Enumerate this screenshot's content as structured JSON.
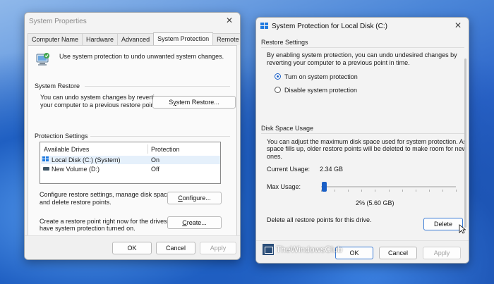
{
  "left_window": {
    "title": "System Properties",
    "close_glyph": "✕",
    "tabs": [
      {
        "label": "Computer Name",
        "active": false
      },
      {
        "label": "Hardware",
        "active": false
      },
      {
        "label": "Advanced",
        "active": false
      },
      {
        "label": "System Protection",
        "active": true
      },
      {
        "label": "Remote",
        "active": false
      }
    ],
    "intro_text": "Use system protection to undo unwanted system changes.",
    "system_restore": {
      "heading": "System Restore",
      "description_line1": "You can undo system changes by reverting",
      "description_line2": "your computer to a previous restore point.",
      "button_pre": "S",
      "button_ul": "y",
      "button_post": "stem Restore..."
    },
    "protection_settings": {
      "heading": "Protection Settings",
      "columns": [
        "Available Drives",
        "Protection"
      ],
      "rows": [
        {
          "drive": "Local Disk (C:) (System)",
          "protection": "On",
          "icon": "windows-drive-icon",
          "selected": true
        },
        {
          "drive": "New Volume (D:)",
          "protection": "Off",
          "icon": "drive-icon",
          "selected": false
        }
      ]
    },
    "configure": {
      "line1": "Configure restore settings, manage disk space,",
      "line2": "and delete restore points.",
      "button_ul": "C",
      "button_post": "onfigure..."
    },
    "create": {
      "line1": "Create a restore point right now for the drives that",
      "line2": "have system protection turned on.",
      "button_ul": "C",
      "button_post": "reate..."
    },
    "buttons": {
      "ok": "OK",
      "cancel": "Cancel",
      "apply": "Apply"
    }
  },
  "right_window": {
    "title": "System Protection for Local Disk (C:)",
    "close_glyph": "✕",
    "restore_settings": {
      "heading": "Restore Settings",
      "line1": "By enabling system protection, you can undo undesired changes by",
      "line2": "reverting your computer to a previous point in time.",
      "option_on": "Turn on system protection",
      "option_off": "Disable system protection",
      "selected": "on"
    },
    "disk_space": {
      "heading": "Disk Space Usage",
      "line1": "You can adjust the maximum disk space used for system protection. As",
      "line2": "space fills up, older restore points will be deleted to make room for new",
      "line3": "ones.",
      "current_label": "Current Usage:",
      "current_value": "2.34 GB",
      "max_label": "Max Usage:",
      "max_percent": 2,
      "max_value_text": "2% (5.60 GB)",
      "delete_text": "Delete all restore points for this drive.",
      "delete_button": "Delete"
    },
    "buttons": {
      "ok": "OK",
      "cancel": "Cancel",
      "apply": "Apply"
    }
  },
  "watermark": {
    "text": "TheWindowsClub"
  },
  "colors": {
    "accent": "#1a5fc6",
    "window_bg": "#f3f3f3",
    "panel_bg": "#fafafa"
  }
}
